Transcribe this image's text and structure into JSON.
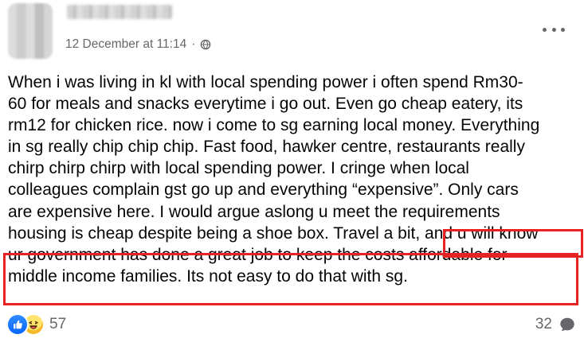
{
  "post": {
    "date": "12 December at 11:14",
    "privacy_separator": "·",
    "body": "When i was living in kl with local spending power i often spend Rm30-\n60 for meals and snacks everytime i go out. Even go cheap eatery, its\nrm12 for chicken rice. now i come to sg earning local money. Everything\nin sg really chip chip chip. Fast food, hawker centre, restaurants really\nchirp chirp chirp with local spending power. I cringe when local\ncolleagues complain gst go up and everything “expensive”. Only cars\nare expensive here. I would argue aslong u meet the requirements\nhousing is cheap despite being a shoe box. Travel a bit, and u will know\nur government has done a great job to keep the costs affordable for\nmiddle income families. Its not easy to do that with sg."
  },
  "reactions": {
    "count": "57",
    "icons": [
      "like-icon",
      "haha-icon"
    ]
  },
  "comments": {
    "count": "32",
    "icon": "comment-icon"
  },
  "colors": {
    "text": "#050505",
    "meta": "#65676b",
    "highlight": "#e62222",
    "like": "#0866ff",
    "haha": "#f7b928"
  }
}
